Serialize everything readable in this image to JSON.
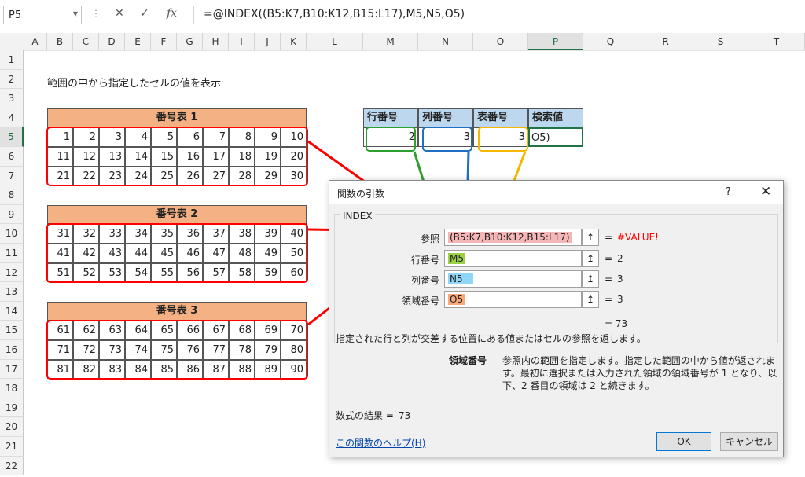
{
  "name_box": "P5",
  "formula": "=@INDEX((B5:K7,B10:K12,B15:L17),M5,N5,O5)",
  "formula_icons": {
    "cancel": "✕",
    "enter": "✓",
    "fx": "fx"
  },
  "columns": [
    "A",
    "B",
    "C",
    "D",
    "E",
    "F",
    "G",
    "H",
    "I",
    "J",
    "K",
    "L",
    "M",
    "N",
    "O",
    "P",
    "Q",
    "R",
    "S",
    "T"
  ],
  "rows": [
    "1",
    "2",
    "3",
    "4",
    "5",
    "6",
    "7",
    "8",
    "9",
    "10",
    "11",
    "12",
    "13",
    "14",
    "15",
    "16",
    "17",
    "18",
    "19",
    "20",
    "21",
    "22"
  ],
  "heading": "範囲の中から指定したセルの値を表示",
  "tables": [
    {
      "title": "番号表 1",
      "rows": [
        [
          "1",
          "2",
          "3",
          "4",
          "5",
          "6",
          "7",
          "8",
          "9",
          "10"
        ],
        [
          "11",
          "12",
          "13",
          "14",
          "15",
          "16",
          "17",
          "18",
          "19",
          "20"
        ],
        [
          "21",
          "22",
          "23",
          "24",
          "25",
          "26",
          "27",
          "28",
          "29",
          "30"
        ]
      ]
    },
    {
      "title": "番号表 2",
      "rows": [
        [
          "31",
          "32",
          "33",
          "34",
          "35",
          "36",
          "37",
          "38",
          "39",
          "40"
        ],
        [
          "41",
          "42",
          "43",
          "44",
          "45",
          "46",
          "47",
          "48",
          "49",
          "50"
        ],
        [
          "51",
          "52",
          "53",
          "54",
          "55",
          "56",
          "57",
          "58",
          "59",
          "60"
        ]
      ]
    },
    {
      "title": "番号表 3",
      "rows": [
        [
          "61",
          "62",
          "63",
          "64",
          "65",
          "66",
          "67",
          "68",
          "69",
          "70"
        ],
        [
          "71",
          "72",
          "73",
          "74",
          "75",
          "76",
          "77",
          "78",
          "79",
          "80"
        ],
        [
          "81",
          "82",
          "83",
          "84",
          "85",
          "86",
          "87",
          "88",
          "89",
          "90"
        ]
      ]
    }
  ],
  "lookup": {
    "headers": [
      "行番号",
      "列番号",
      "表番号",
      "検索値"
    ],
    "values": [
      "2",
      "3",
      "3",
      "O5)"
    ]
  },
  "dialog": {
    "title": "関数の引数",
    "help_icon": "?",
    "close_icon": "✕",
    "function_name": "INDEX",
    "args": [
      {
        "label": "参照",
        "value": "(B5:K7,B10:K12,B15:L17)",
        "result": "#VALUE!"
      },
      {
        "label": "行番号",
        "value": "M5",
        "result": "2"
      },
      {
        "label": "列番号",
        "value": "N5",
        "result": "3"
      },
      {
        "label": "領域番号",
        "value": "O5",
        "result": "3"
      }
    ],
    "ref_button_icon": "↥",
    "equals": "=",
    "overall_result": "= 73",
    "description": "指定された行と列が交差する位置にある値またはセルの参照を返します。",
    "arg_name": "領域番号",
    "arg_description": "参照内の範囲を指定します。指定した範囲の中から値が返されます。最初に選択または入力された領域の領域番号が 1 となり、以下、2 番目の領域は 2 と続きます。",
    "formula_result_label": "数式の結果 =",
    "formula_result": "73",
    "help_link": "この関数のヘルプ(H)",
    "ok": "OK",
    "cancel": "キャンセル"
  },
  "colors": {
    "table_header": "#f4b183",
    "lookup_header": "#bdd7ee",
    "error": "#ff0000",
    "ref_fill": "#f4b6b6",
    "row_fill": "#9bd243",
    "col_fill": "#8fd6f7",
    "area_fill": "#f8a87a",
    "green": "#2ca02c",
    "blue": "#1f6fc5",
    "orange": "#f5b800",
    "red": "#ff0000"
  }
}
